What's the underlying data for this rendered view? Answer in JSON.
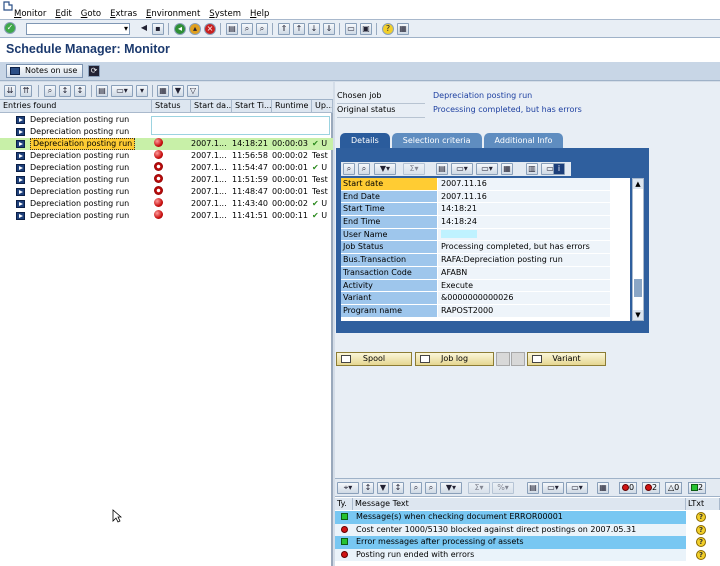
{
  "menubar": {
    "items": [
      "Monitor",
      "Edit",
      "Goto",
      "Extras",
      "Environment",
      "System",
      "Help"
    ]
  },
  "title": "Schedule Manager: Monitor",
  "app_toolbar": {
    "notes_label": "Notes on use"
  },
  "left": {
    "headers": [
      "Entries found",
      "Status",
      "Start da...",
      "Start Ti...",
      "Runtime",
      "Up..."
    ],
    "rows": [
      {
        "name": "Depreciation posting run",
        "status": "",
        "date": "",
        "time": "",
        "runtime": "",
        "up": "",
        "selected": false,
        "check": false
      },
      {
        "name": "Depreciation posting run",
        "status": "",
        "date": "",
        "time": "",
        "runtime": "",
        "up": "",
        "selected": false,
        "check": false
      },
      {
        "name": "Depreciation posting run",
        "status": "error",
        "date": "2007.1...",
        "time": "14:18:21",
        "runtime": "00:00:03",
        "up": "U",
        "selected": true,
        "check": true
      },
      {
        "name": "Depreciation posting run",
        "status": "error",
        "date": "2007.1...",
        "time": "11:56:58",
        "runtime": "00:00:02",
        "up": "Test",
        "selected": false,
        "check": false
      },
      {
        "name": "Depreciation posting run",
        "status": "stop",
        "date": "2007.1...",
        "time": "11:54:47",
        "runtime": "00:00:01",
        "up": "U",
        "selected": false,
        "check": true
      },
      {
        "name": "Depreciation posting run",
        "status": "stop",
        "date": "2007.1...",
        "time": "11:51:59",
        "runtime": "00:00:01",
        "up": "Test",
        "selected": false,
        "check": false
      },
      {
        "name": "Depreciation posting run",
        "status": "stop",
        "date": "2007.1...",
        "time": "11:48:47",
        "runtime": "00:00:01",
        "up": "Test",
        "selected": false,
        "check": false
      },
      {
        "name": "Depreciation posting run",
        "status": "error",
        "date": "2007.1...",
        "time": "11:43:40",
        "runtime": "00:00:02",
        "up": "U",
        "selected": false,
        "check": true
      },
      {
        "name": "Depreciation posting run",
        "status": "error",
        "date": "2007.1...",
        "time": "11:41:51",
        "runtime": "00:00:11",
        "up": "U",
        "selected": false,
        "check": true
      }
    ]
  },
  "right": {
    "chosen_job_label": "Chosen job",
    "chosen_job_value": "Depreciation posting run",
    "original_status_label": "Original status",
    "original_status_value": "Processing completed, but has errors",
    "tabs": [
      "Details",
      "Selection criteria",
      "Additional Info"
    ],
    "details": [
      {
        "k": "Start date",
        "v": "2007.11.16"
      },
      {
        "k": "End Date",
        "v": "2007.11.16"
      },
      {
        "k": "Start Time",
        "v": "14:18:21"
      },
      {
        "k": "End Time",
        "v": "14:18:24"
      },
      {
        "k": "User Name",
        "v": ""
      },
      {
        "k": "Job Status",
        "v": "Processing completed, but has errors"
      },
      {
        "k": "Bus.Transaction",
        "v": "RAFA:Depreciation posting run"
      },
      {
        "k": "Transaction Code",
        "v": "AFABN"
      },
      {
        "k": "Activity",
        "v": "Execute"
      },
      {
        "k": "Variant",
        "v": "&0000000000026"
      },
      {
        "k": "Program name",
        "v": "RAPOST2000"
      }
    ],
    "buttons": {
      "spool": "Spool",
      "job_log": "Job log",
      "variant": "Variant"
    }
  },
  "messages": {
    "headers": [
      "Ty.",
      "Message Text",
      "LTxt"
    ],
    "counters": [
      "0",
      "2",
      "2"
    ],
    "rows": [
      {
        "type": "green",
        "text": "Message(s) when checking document ERROR00001",
        "style": "b"
      },
      {
        "type": "red",
        "text": "Cost center 1000/5130 blocked against direct postings on 2007.05.31",
        "style": "w"
      },
      {
        "type": "green",
        "text": "Error messages after processing of assets",
        "style": "b"
      },
      {
        "type": "red",
        "text": "Posting run ended with errors",
        "style": "w"
      }
    ]
  }
}
